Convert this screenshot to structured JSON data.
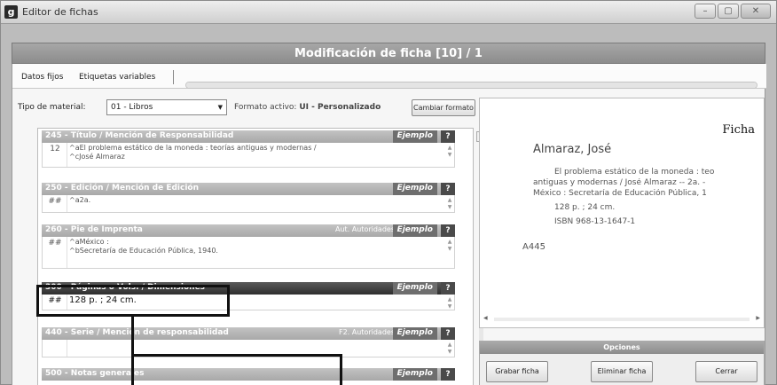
{
  "window": {
    "title": "Editor de fichas",
    "icon": "g",
    "controls": {
      "minimize": "–",
      "maximize": "▢",
      "close": "✕"
    }
  },
  "header": {
    "title": "Modificación de ficha [10] / 1"
  },
  "tabs": [
    {
      "label": "Datos fijos"
    },
    {
      "label": "Etiquetas variables"
    }
  ],
  "toolbar": {
    "tipo_label": "Tipo de material:",
    "tipo_value": "01 - Libros",
    "formato_label": "Formato activo:",
    "formato_value": "UI - Personalizado",
    "cambiar_button": "Cambiar formato"
  },
  "fields": [
    {
      "tag": "245 - Título / Mención de Responsabilidad",
      "ejemplo": "Ejemplo",
      "help": "?",
      "extra": "",
      "indicator": "12",
      "value": "^aEl problema estático de la moneda : teorías antiguas y modernas /\n^cJosé Almaraz"
    },
    {
      "tag": "250 - Edición / Mención de Edición",
      "ejemplo": "Ejemplo",
      "help": "?",
      "extra": "",
      "indicator": "##",
      "value": "^a2a."
    },
    {
      "tag": "260 - Pie de Imprenta",
      "ejemplo": "Ejemplo",
      "help": "?",
      "extra": "Aut. Autoridades",
      "indicator": "##",
      "value": "^aMéxico :\n^bSecretaría de Educación Pública, 1940."
    },
    {
      "tag": "300 - Páginas o Vols. / Dimensiones",
      "ejemplo": "Ejemplo",
      "help": "?",
      "extra": "",
      "indicator": "##",
      "value": "128 p. ; 24 cm."
    },
    {
      "tag": "440 - Serie / Mención de responsabilidad",
      "ejemplo": "Ejemplo",
      "help": "?",
      "extra": "F2. Autoridades",
      "indicator": "",
      "value": ""
    },
    {
      "tag": "500 - Notas generales",
      "ejemplo": "Ejemplo",
      "help": "?",
      "extra": "",
      "indicator": "",
      "value": ""
    }
  ],
  "preview": {
    "heading": "Ficha",
    "author": "Almaraz, José",
    "lines": [
      "El problema estático de la moneda : teo",
      "antiguas y modernas / José Almaraz -- 2a. -",
      "México : Secretaría de Educación Pública, 1",
      "128 p. ; 24 cm.",
      "ISBN 968-13-1647-1"
    ],
    "code": "A445"
  },
  "options": {
    "title": "Opciones",
    "buttons": [
      "Grabar ficha",
      "Eliminar ficha",
      "Cerrar"
    ]
  },
  "progress_fraction": 1.0
}
